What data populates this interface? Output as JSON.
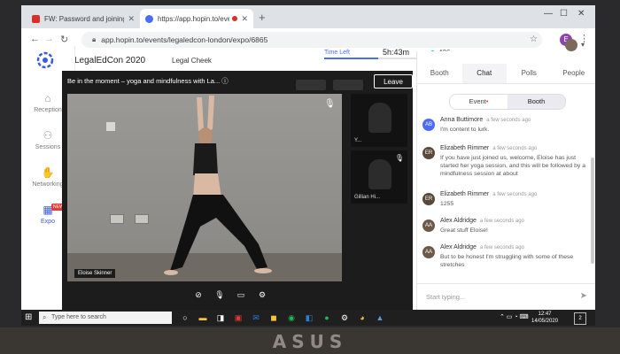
{
  "browser": {
    "tabs": [
      {
        "title": "FW: Password and joining instru...",
        "favicon_color": "#d93025"
      },
      {
        "title": "https://app.hopin.to/events/l...",
        "favicon_color": "#4a6cf7"
      }
    ],
    "new_tab": "+",
    "url": "app.hopin.to/events/legaledcon-london/expo/6865",
    "profile_initial": "E"
  },
  "header": {
    "event_title": "LegalEdCon 2020",
    "organizer": "Legal Cheek",
    "time_left_label": "Time Left",
    "time_left_value": "5h:43m",
    "online_count": "426",
    "time_progress": 0.55
  },
  "sidebar": {
    "items": [
      {
        "label": "Reception",
        "icon": "home-icon",
        "glyph": "⌂"
      },
      {
        "label": "Sessions",
        "icon": "sessions-icon",
        "glyph": "⚇"
      },
      {
        "label": "Networking",
        "icon": "handshake-icon",
        "glyph": "✋"
      },
      {
        "label": "Expo",
        "icon": "expo-icon",
        "glyph": "▦",
        "badge": "NEW"
      }
    ]
  },
  "stage": {
    "title": "Be in the moment – yoga and mindfulness with La...",
    "leave_label": "Leave",
    "presenter_name": "Eloise Skinner",
    "thumbnails": [
      {
        "name": "Y..."
      },
      {
        "name": "Gillian Hi..."
      }
    ]
  },
  "panel": {
    "tabs": [
      "Booth",
      "Chat",
      "Polls",
      "People"
    ],
    "selected_tab": "Chat",
    "segments": [
      "Event",
      "Booth"
    ],
    "selected_segment": "Booth",
    "messages": [
      {
        "initials": "AB",
        "name": "Anna Buttimore",
        "time": "a few seconds ago",
        "text": "I'm content to lurk.",
        "color": "#4a6cf7"
      },
      {
        "initials": "ER",
        "name": "Elizabeth Rimmer",
        "time": "a few seconds ago",
        "text": "If you have just joined us, welcome, Eloise has just started her yoga session, and this will be followed by a mindfulness session at about",
        "color": "#5a4a3a"
      },
      {
        "initials": "ER",
        "name": "Elizabeth Rimmer",
        "time": "a few seconds ago",
        "text": "1255",
        "color": "#5a4a3a"
      },
      {
        "initials": "AA",
        "name": "Alex Aldridge",
        "time": "a few seconds ago",
        "text": "Great stuff Eloise!",
        "color": "#6b5a4a"
      },
      {
        "initials": "AA",
        "name": "Alex Aldridge",
        "time": "a few seconds ago",
        "text": "But to be honest I'm struggling with some of these stretches",
        "color": "#6b5a4a"
      }
    ],
    "input_placeholder": "Start typing..."
  },
  "taskbar": {
    "search_placeholder": "Type here to search",
    "time": "12:47",
    "date": "14/05/2020",
    "notifications": "2"
  },
  "device_brand": "ASUS"
}
